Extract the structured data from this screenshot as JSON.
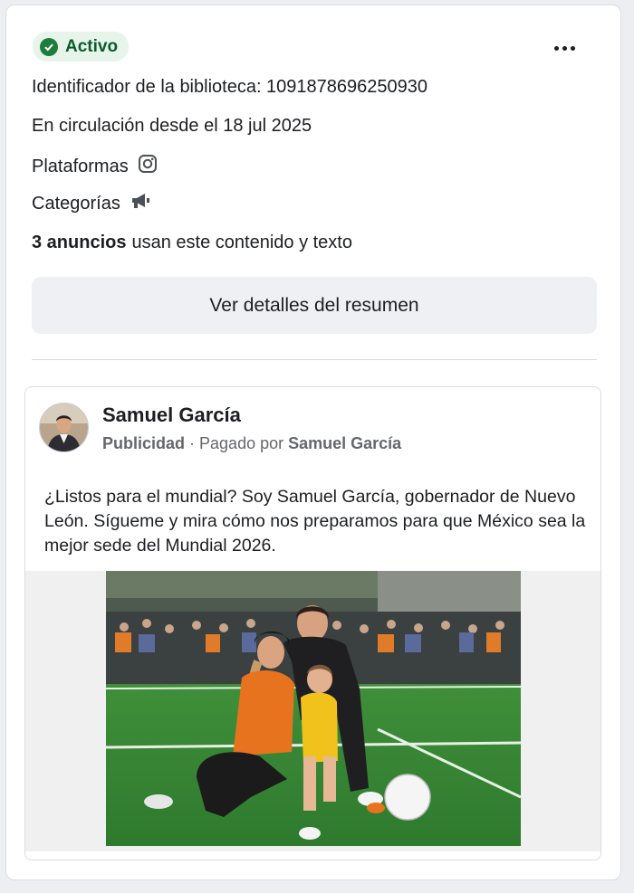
{
  "status": {
    "label": "Activo",
    "icon": "check-circle-icon",
    "color": "#1e7d3d"
  },
  "menu": {
    "icon": "more-options-icon"
  },
  "details": {
    "library_id": "Identificador de la biblioteca: 1091878696250930",
    "running_since": "En circulación desde el 18 jul 2025",
    "platforms_label": "Plataformas",
    "platform_icon": "instagram-icon",
    "categories_label": "Categorías",
    "category_icon": "megaphone-icon",
    "ads_count": "3 anuncios",
    "ads_count_suffix": "usan este contenido y texto"
  },
  "summary_button": {
    "label": "Ver detalles del resumen"
  },
  "ad": {
    "advertiser": "Samuel García",
    "sponsored_label": "Publicidad",
    "paid_by_prefix": "· Pagado por",
    "paid_by_name": "Samuel García",
    "body": "¿Listos para el mundial? Soy Samuel García, gobernador de Nuevo León. Sígueme y mira cómo nos preparamos para que México sea la mejor sede del Mundial 2026."
  }
}
